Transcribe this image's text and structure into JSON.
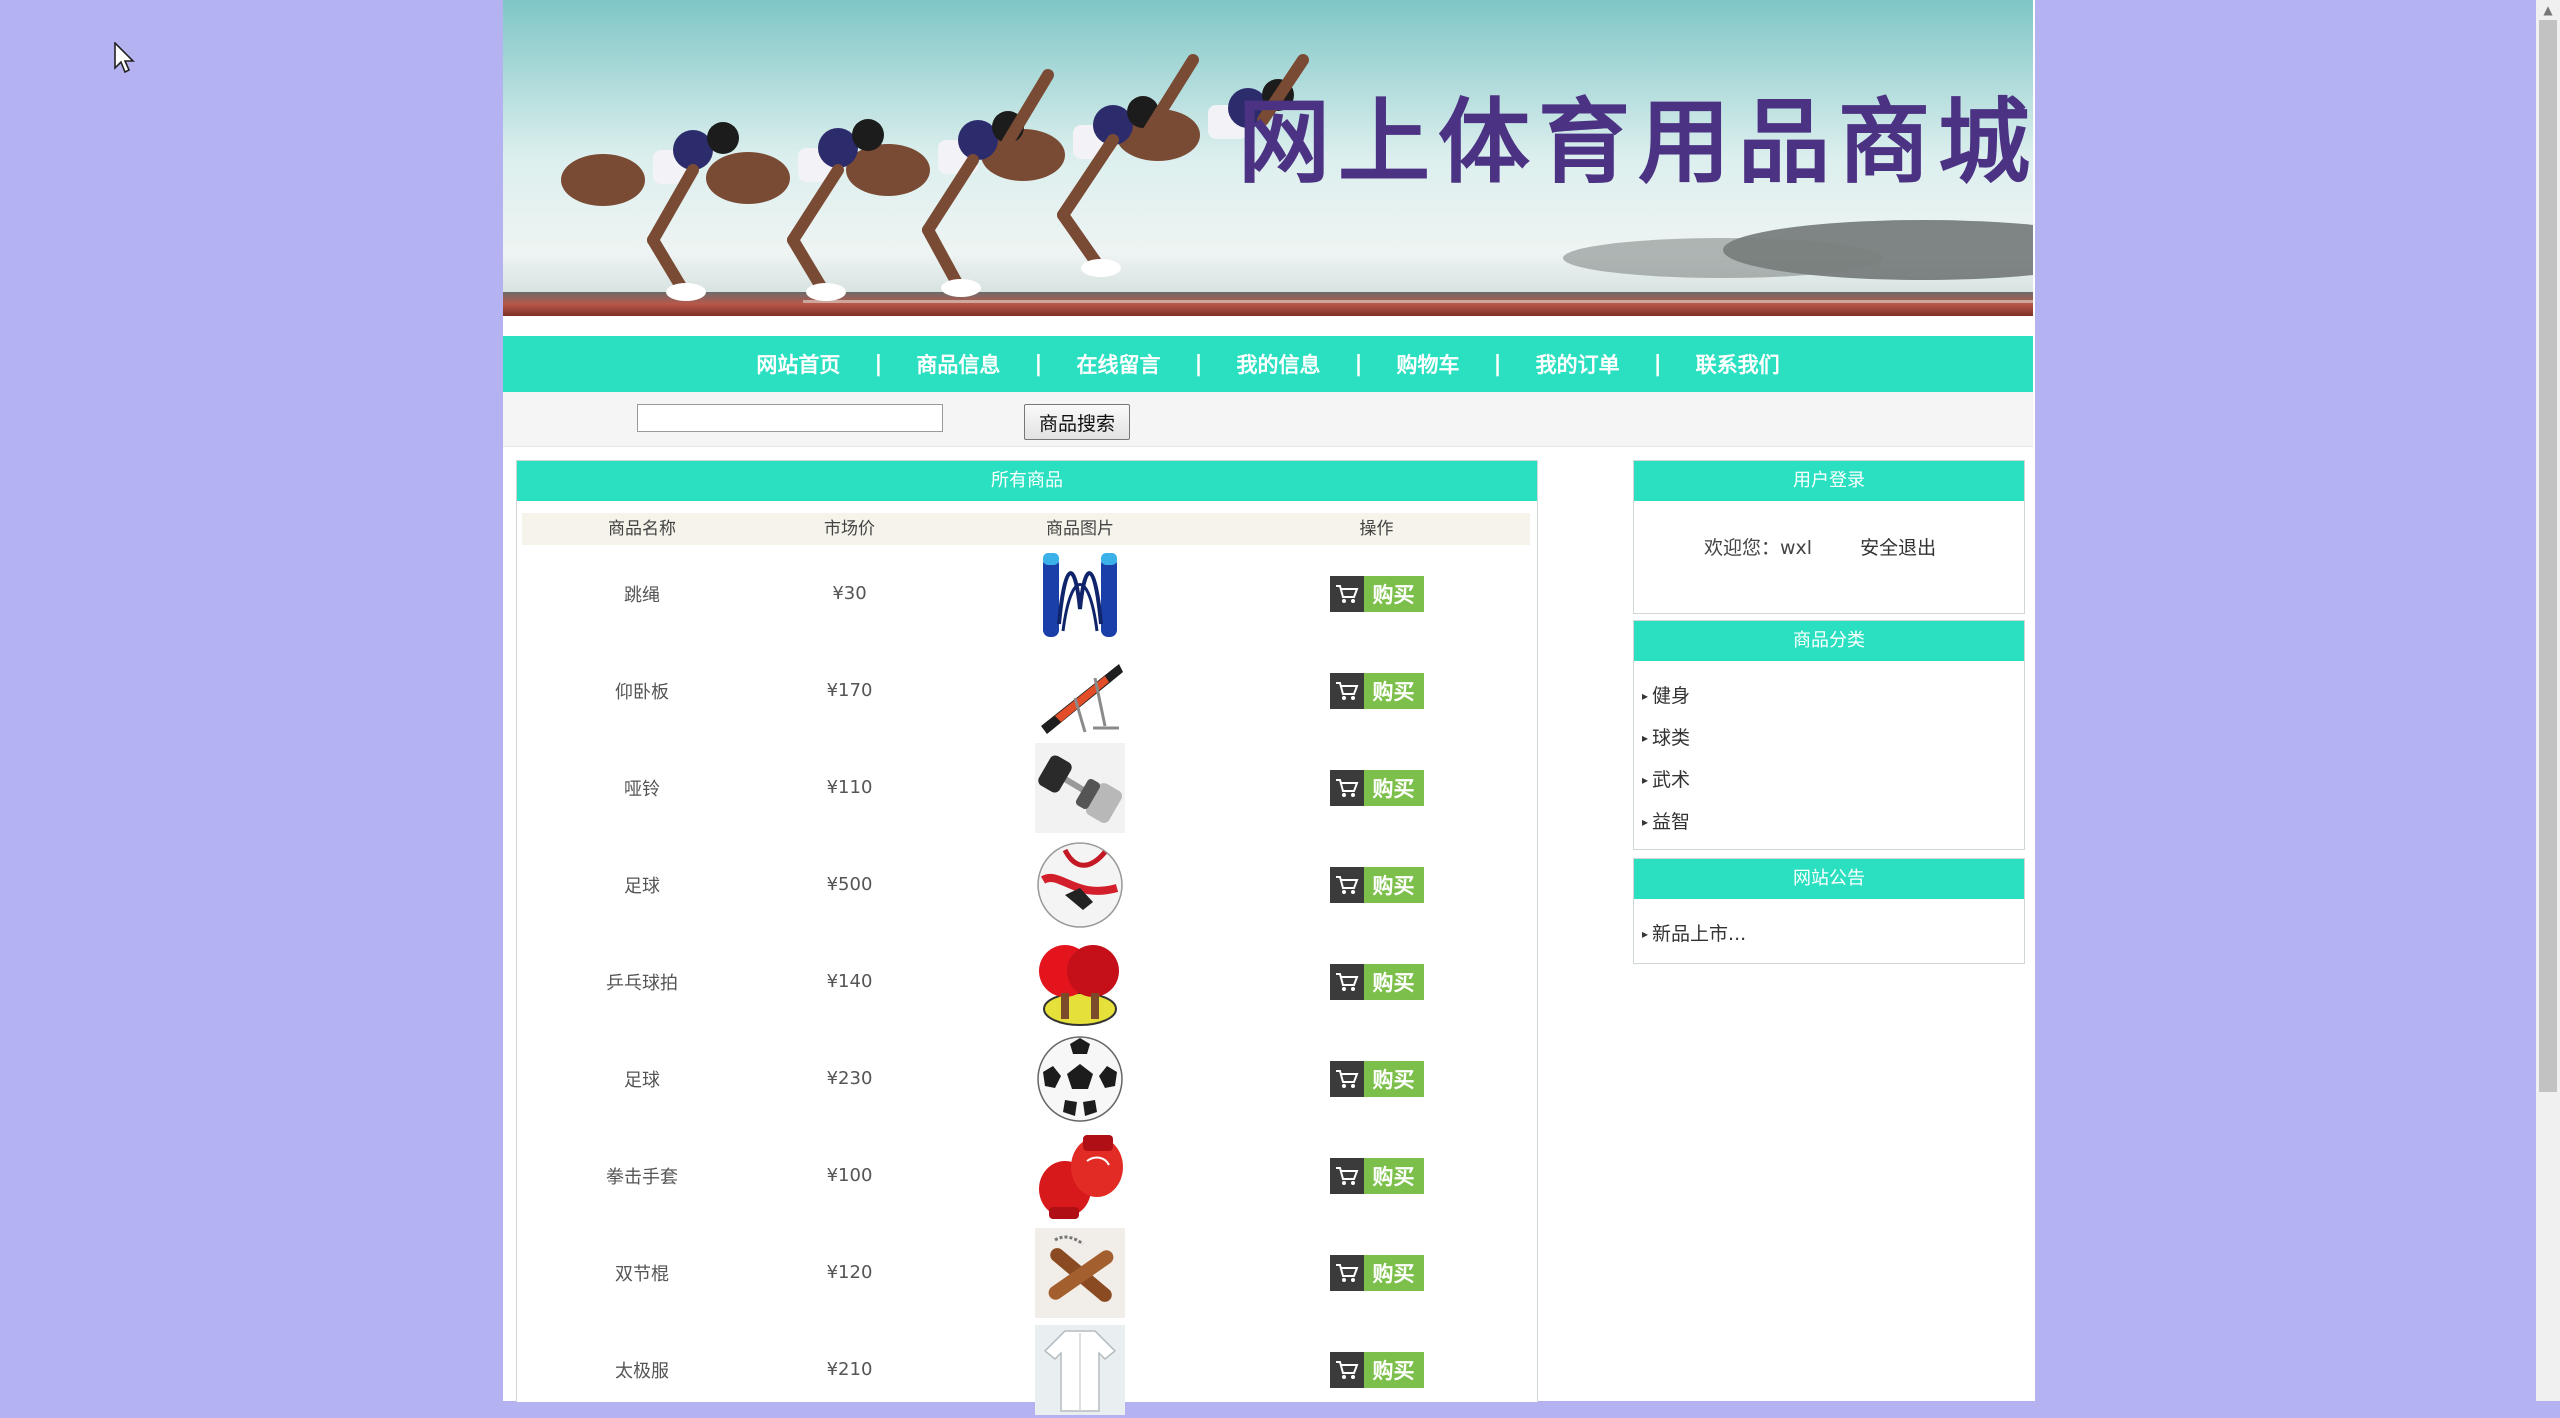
{
  "header": {
    "site_title": "网上体育用品商城"
  },
  "nav": {
    "items": [
      "网站首页",
      "商品信息",
      "在线留言",
      "我的信息",
      "购物车",
      "我的订单",
      "联系我们"
    ],
    "separator": "|"
  },
  "search": {
    "input_value": "",
    "button_label": "商品搜索"
  },
  "products": {
    "title": "所有商品",
    "columns": [
      "商品名称",
      "市场价",
      "商品图片",
      "操作"
    ],
    "buy_label": "购买",
    "rows": [
      {
        "name": "跳绳",
        "price": "¥30",
        "image": "jump-rope-icon"
      },
      {
        "name": "仰卧板",
        "price": "¥170",
        "image": "sit-up-bench-icon"
      },
      {
        "name": "哑铃",
        "price": "¥110",
        "image": "dumbbell-icon"
      },
      {
        "name": "足球",
        "price": "¥500",
        "image": "soccer-ball-icon"
      },
      {
        "name": "乒乓球拍",
        "price": "¥140",
        "image": "ping-pong-paddle-icon"
      },
      {
        "name": "足球",
        "price": "¥230",
        "image": "soccer-ball-icon"
      },
      {
        "name": "拳击手套",
        "price": "¥100",
        "image": "boxing-gloves-icon"
      },
      {
        "name": "双节棍",
        "price": "¥120",
        "image": "nunchaku-icon"
      },
      {
        "name": "太极服",
        "price": "¥210",
        "image": "tai-chi-uniform-icon"
      }
    ]
  },
  "login": {
    "title": "用户登录",
    "welcome": "欢迎您：wxl",
    "logout": "安全退出"
  },
  "categories": {
    "title": "商品分类",
    "items": [
      "健身",
      "球类",
      "武术",
      "益智"
    ]
  },
  "notice": {
    "title": "网站公告",
    "items": [
      "新品上市..."
    ]
  },
  "colors": {
    "page_background": "#b5b2f2",
    "accent": "#2ae0c1",
    "buy_green": "#7cc04b",
    "title_purple": "#4b3283"
  }
}
